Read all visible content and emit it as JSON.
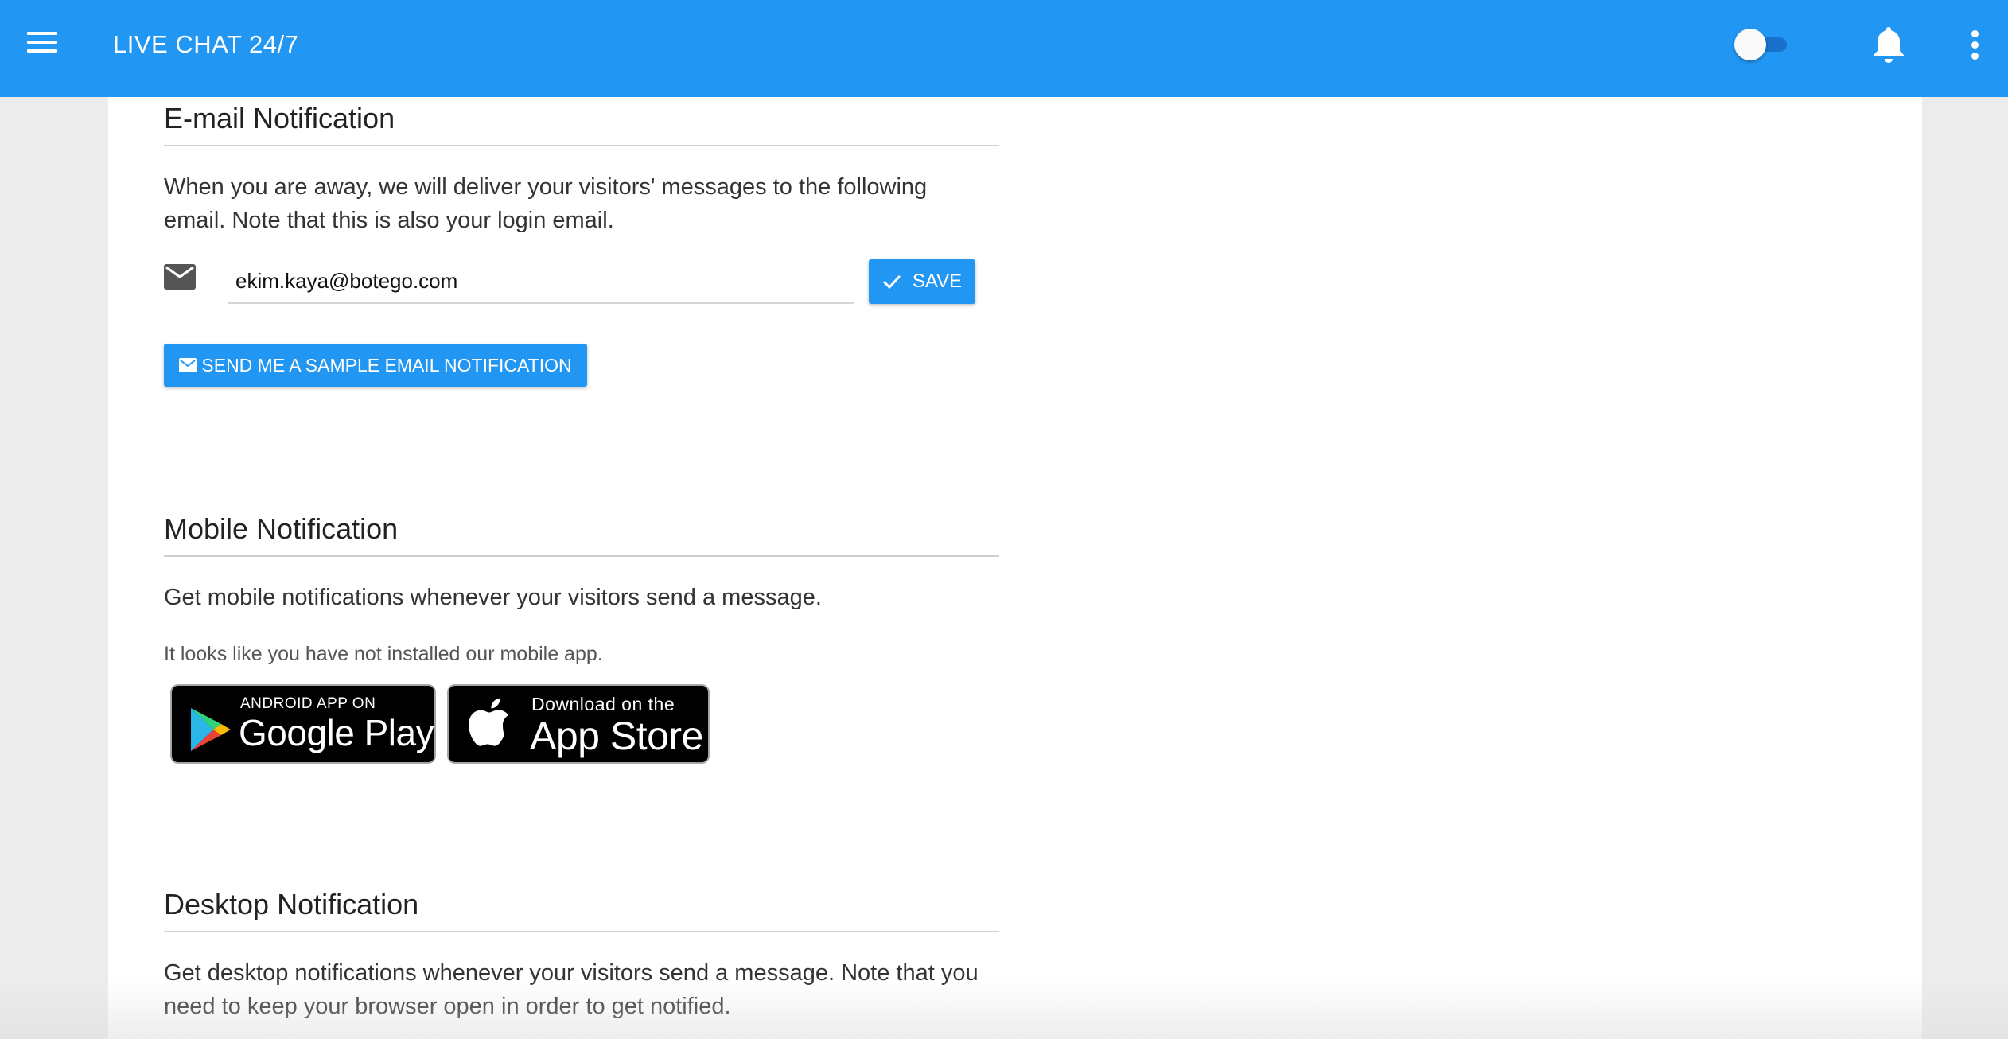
{
  "appbar": {
    "title": "LIVE CHAT 24/7",
    "menu_icon": "menu-icon",
    "toggle_state": "off",
    "bell_icon": "notifications-icon",
    "more_icon": "more-vertical-icon"
  },
  "email_section": {
    "title": "E-mail Notification",
    "description": "When you are away, we will deliver your visitors' messages to the following email. Note that this is also your login email.",
    "email_value": "ekim.kaya@botego.com",
    "save_label": "SAVE",
    "sample_button_label": "SEND ME A SAMPLE EMAIL NOTIFICATION"
  },
  "mobile_section": {
    "title": "Mobile Notification",
    "description": "Get mobile notifications whenever your visitors send a message.",
    "note": "It looks like you have not installed our mobile app.",
    "google_play": {
      "small": "ANDROID APP ON",
      "big": "Google Play"
    },
    "app_store": {
      "small": "Download on the",
      "big": "App Store"
    }
  },
  "desktop_section": {
    "title": "Desktop Notification",
    "description": "Get desktop notifications whenever your visitors send a message. Note that you need to keep your browser open in order to get notified."
  },
  "colors": {
    "primary": "#2196f3",
    "background": "#ececec",
    "card": "#ffffff"
  }
}
